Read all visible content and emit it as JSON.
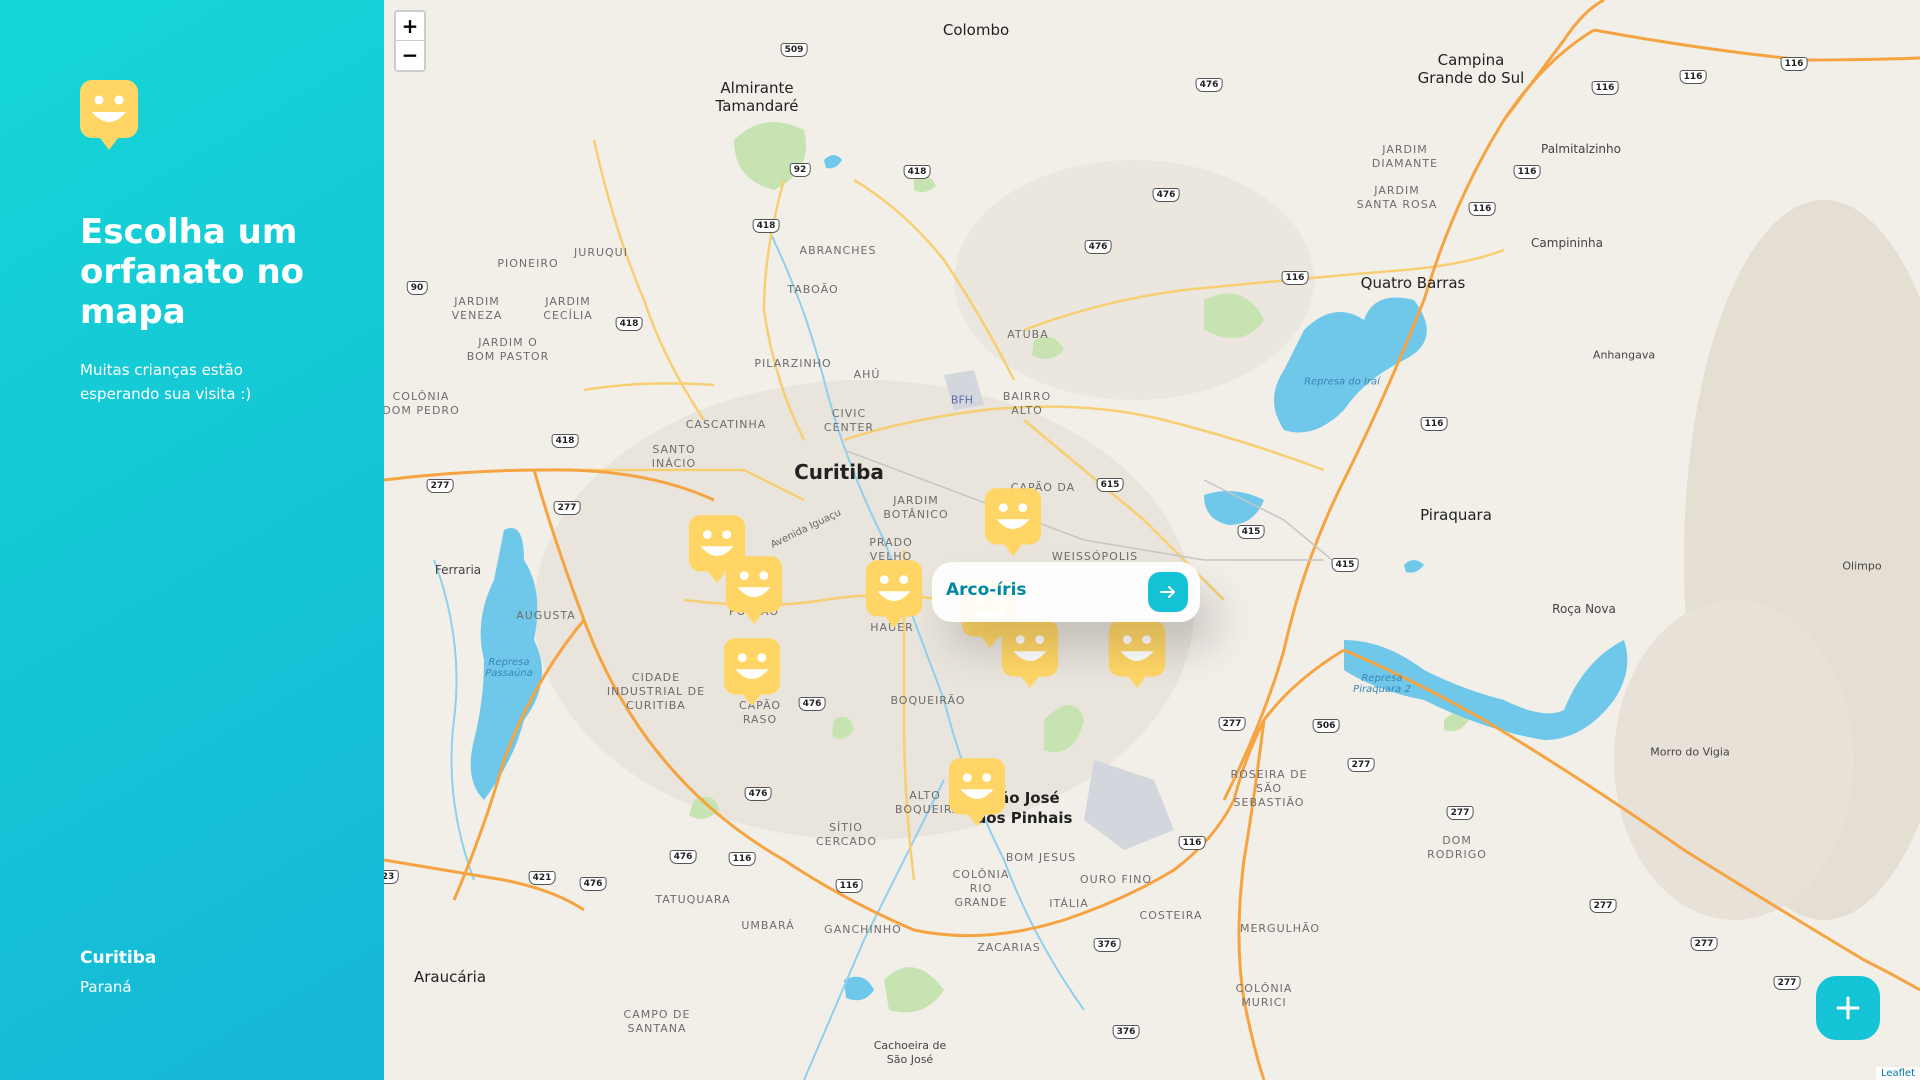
{
  "sidebar": {
    "title": "Escolha um orfanato no mapa",
    "subtitle": "Muitas crianças estão esperando sua visita :)",
    "city": "Curitiba",
    "state": "Paraná",
    "logo_icon": "smiley-pin-icon"
  },
  "map": {
    "zoom_in_label": "+",
    "zoom_out_label": "−",
    "attribution": "Leaflet",
    "labels": {
      "colombo": "Colombo",
      "almirante": "Almirante Tamandaré",
      "campina": "Campina Grande do Sul",
      "palmitalzinho": "Palmitalzinho",
      "campininha": "Campininha",
      "quatro_barras": "Quatro Barras",
      "anhangava": "Anhangava",
      "curitiba": "Curitiba",
      "piraquara": "Piraquara",
      "olimpo": "Olimpo",
      "roca_nova": "Roça Nova",
      "ferraria": "Ferraria",
      "morro_vigia": "Morro do Vigia",
      "sao_jose": "São José dos Pinhais",
      "araucaria": "Araucária",
      "cachoeira": "Cachoeira de São José",
      "bfh": "BFH",
      "avenida": "Avenida Iguaçu",
      "represa_irai": "Represa do Iraí",
      "represa_passauna": "Represa Passaúna",
      "represa_piraquara": "Represa Piraquara 2"
    },
    "neighborhoods": [
      "Jardim Diamante",
      "Jardim Santa Rosa",
      "Pioneiro",
      "Juruqui",
      "Abranches",
      "Taboão",
      "Jardim Veneza",
      "Jardim Cecília",
      "Jardim O Bom Pastor",
      "Pilarzinho",
      "Ahú",
      "Atuba",
      "Bairro Alto",
      "Colônia Dom Pedro",
      "Cascatinha",
      "Civic Center",
      "Santo Inácio",
      "Jardim Botânico",
      "Capão da",
      "Weissópolis",
      "Prado Velho",
      "Augusta",
      "Cidade Industrial de Curitiba",
      "Boqueirão",
      "Hauer",
      "Capão Raso",
      "Portão",
      "Alto Boqueirão",
      "Sítio Cercado",
      "Bom Jesus",
      "Ouro Fino",
      "Colônia Rio Grande",
      "Itália",
      "Costeira",
      "Umbará",
      "Ganchinho",
      "Tatuquara",
      "Zacarias",
      "Mergulhão",
      "Colônia Murici",
      "Roseira de São Sebastião",
      "Dom Rodrigo",
      "Campo de Santana"
    ],
    "shields": [
      "509",
      "476",
      "418",
      "92",
      "418",
      "476",
      "476",
      "116",
      "116",
      "116",
      "116",
      "116",
      "116",
      "90",
      "418",
      "418",
      "277",
      "277",
      "277",
      "615",
      "415",
      "415",
      "116",
      "277",
      "506",
      "277",
      "277",
      "277",
      "277",
      "476",
      "476",
      "476",
      "421",
      "476",
      "116",
      "116",
      "376",
      "376",
      "116",
      "23"
    ],
    "markers_count": 9,
    "popup": {
      "name": "Arco-íris",
      "button_icon": "arrow-right-icon"
    },
    "add_button_icon": "plus-icon"
  },
  "colors": {
    "sidebar_from": "#15d6d6",
    "sidebar_to": "#15b6d6",
    "marker": "#ffd666",
    "accent": "#15c3d6",
    "popup_text": "#0089a5",
    "water": "#6fc7ea",
    "park": "#c7e3b1",
    "road_major": "#f5a441",
    "road_minor": "#f7cf72"
  }
}
